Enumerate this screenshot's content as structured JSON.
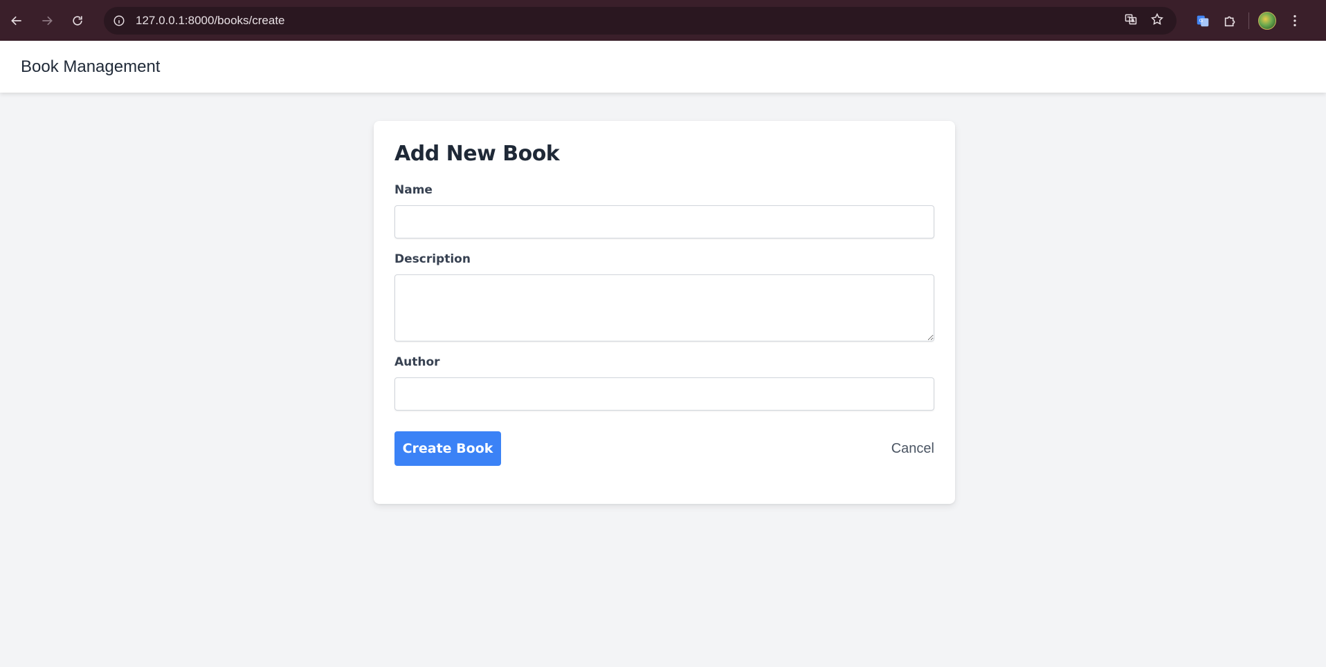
{
  "browser": {
    "url": "127.0.0.1:8000/books/create",
    "icons": [
      "back-icon",
      "forward-icon",
      "reload-icon",
      "site-info-icon",
      "translate-icon",
      "bookmark-star-icon",
      "google-translate-extension-icon",
      "extensions-puzzle-icon",
      "profile-avatar",
      "more-menu-icon"
    ]
  },
  "header": {
    "title": "Book Management"
  },
  "form": {
    "title": "Add New Book",
    "name_label": "Name",
    "name_value": "",
    "description_label": "Description",
    "description_value": "",
    "author_label": "Author",
    "author_value": "",
    "submit_label": "Create Book",
    "cancel_label": "Cancel"
  },
  "colors": {
    "primary": "#3b82f6",
    "page_background": "#f3f4f6",
    "chrome_background": "#3a1f2a"
  }
}
